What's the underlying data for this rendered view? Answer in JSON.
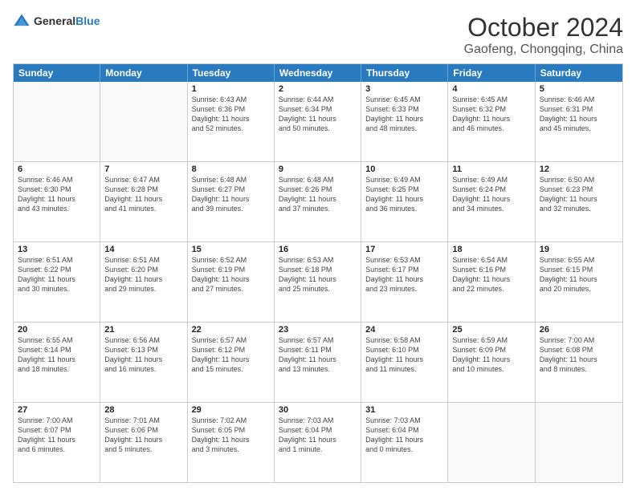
{
  "header": {
    "logo_general": "General",
    "logo_blue": "Blue",
    "month_title": "October 2024",
    "location": "Gaofeng, Chongqing, China"
  },
  "weekdays": [
    "Sunday",
    "Monday",
    "Tuesday",
    "Wednesday",
    "Thursday",
    "Friday",
    "Saturday"
  ],
  "rows": [
    [
      {
        "day": "",
        "info": "",
        "empty": true
      },
      {
        "day": "",
        "info": "",
        "empty": true
      },
      {
        "day": "1",
        "info": "Sunrise: 6:43 AM\nSunset: 6:36 PM\nDaylight: 11 hours\nand 52 minutes."
      },
      {
        "day": "2",
        "info": "Sunrise: 6:44 AM\nSunset: 6:34 PM\nDaylight: 11 hours\nand 50 minutes."
      },
      {
        "day": "3",
        "info": "Sunrise: 6:45 AM\nSunset: 6:33 PM\nDaylight: 11 hours\nand 48 minutes."
      },
      {
        "day": "4",
        "info": "Sunrise: 6:45 AM\nSunset: 6:32 PM\nDaylight: 11 hours\nand 46 minutes."
      },
      {
        "day": "5",
        "info": "Sunrise: 6:46 AM\nSunset: 6:31 PM\nDaylight: 11 hours\nand 45 minutes."
      }
    ],
    [
      {
        "day": "6",
        "info": "Sunrise: 6:46 AM\nSunset: 6:30 PM\nDaylight: 11 hours\nand 43 minutes."
      },
      {
        "day": "7",
        "info": "Sunrise: 6:47 AM\nSunset: 6:28 PM\nDaylight: 11 hours\nand 41 minutes."
      },
      {
        "day": "8",
        "info": "Sunrise: 6:48 AM\nSunset: 6:27 PM\nDaylight: 11 hours\nand 39 minutes."
      },
      {
        "day": "9",
        "info": "Sunrise: 6:48 AM\nSunset: 6:26 PM\nDaylight: 11 hours\nand 37 minutes."
      },
      {
        "day": "10",
        "info": "Sunrise: 6:49 AM\nSunset: 6:25 PM\nDaylight: 11 hours\nand 36 minutes."
      },
      {
        "day": "11",
        "info": "Sunrise: 6:49 AM\nSunset: 6:24 PM\nDaylight: 11 hours\nand 34 minutes."
      },
      {
        "day": "12",
        "info": "Sunrise: 6:50 AM\nSunset: 6:23 PM\nDaylight: 11 hours\nand 32 minutes."
      }
    ],
    [
      {
        "day": "13",
        "info": "Sunrise: 6:51 AM\nSunset: 6:22 PM\nDaylight: 11 hours\nand 30 minutes."
      },
      {
        "day": "14",
        "info": "Sunrise: 6:51 AM\nSunset: 6:20 PM\nDaylight: 11 hours\nand 29 minutes."
      },
      {
        "day": "15",
        "info": "Sunrise: 6:52 AM\nSunset: 6:19 PM\nDaylight: 11 hours\nand 27 minutes."
      },
      {
        "day": "16",
        "info": "Sunrise: 6:53 AM\nSunset: 6:18 PM\nDaylight: 11 hours\nand 25 minutes."
      },
      {
        "day": "17",
        "info": "Sunrise: 6:53 AM\nSunset: 6:17 PM\nDaylight: 11 hours\nand 23 minutes."
      },
      {
        "day": "18",
        "info": "Sunrise: 6:54 AM\nSunset: 6:16 PM\nDaylight: 11 hours\nand 22 minutes."
      },
      {
        "day": "19",
        "info": "Sunrise: 6:55 AM\nSunset: 6:15 PM\nDaylight: 11 hours\nand 20 minutes."
      }
    ],
    [
      {
        "day": "20",
        "info": "Sunrise: 6:55 AM\nSunset: 6:14 PM\nDaylight: 11 hours\nand 18 minutes."
      },
      {
        "day": "21",
        "info": "Sunrise: 6:56 AM\nSunset: 6:13 PM\nDaylight: 11 hours\nand 16 minutes."
      },
      {
        "day": "22",
        "info": "Sunrise: 6:57 AM\nSunset: 6:12 PM\nDaylight: 11 hours\nand 15 minutes."
      },
      {
        "day": "23",
        "info": "Sunrise: 6:57 AM\nSunset: 6:11 PM\nDaylight: 11 hours\nand 13 minutes."
      },
      {
        "day": "24",
        "info": "Sunrise: 6:58 AM\nSunset: 6:10 PM\nDaylight: 11 hours\nand 11 minutes."
      },
      {
        "day": "25",
        "info": "Sunrise: 6:59 AM\nSunset: 6:09 PM\nDaylight: 11 hours\nand 10 minutes."
      },
      {
        "day": "26",
        "info": "Sunrise: 7:00 AM\nSunset: 6:08 PM\nDaylight: 11 hours\nand 8 minutes."
      }
    ],
    [
      {
        "day": "27",
        "info": "Sunrise: 7:00 AM\nSunset: 6:07 PM\nDaylight: 11 hours\nand 6 minutes."
      },
      {
        "day": "28",
        "info": "Sunrise: 7:01 AM\nSunset: 6:06 PM\nDaylight: 11 hours\nand 5 minutes."
      },
      {
        "day": "29",
        "info": "Sunrise: 7:02 AM\nSunset: 6:05 PM\nDaylight: 11 hours\nand 3 minutes."
      },
      {
        "day": "30",
        "info": "Sunrise: 7:03 AM\nSunset: 6:04 PM\nDaylight: 11 hours\nand 1 minute."
      },
      {
        "day": "31",
        "info": "Sunrise: 7:03 AM\nSunset: 6:04 PM\nDaylight: 11 hours\nand 0 minutes."
      },
      {
        "day": "",
        "info": "",
        "empty": true
      },
      {
        "day": "",
        "info": "",
        "empty": true
      }
    ]
  ]
}
